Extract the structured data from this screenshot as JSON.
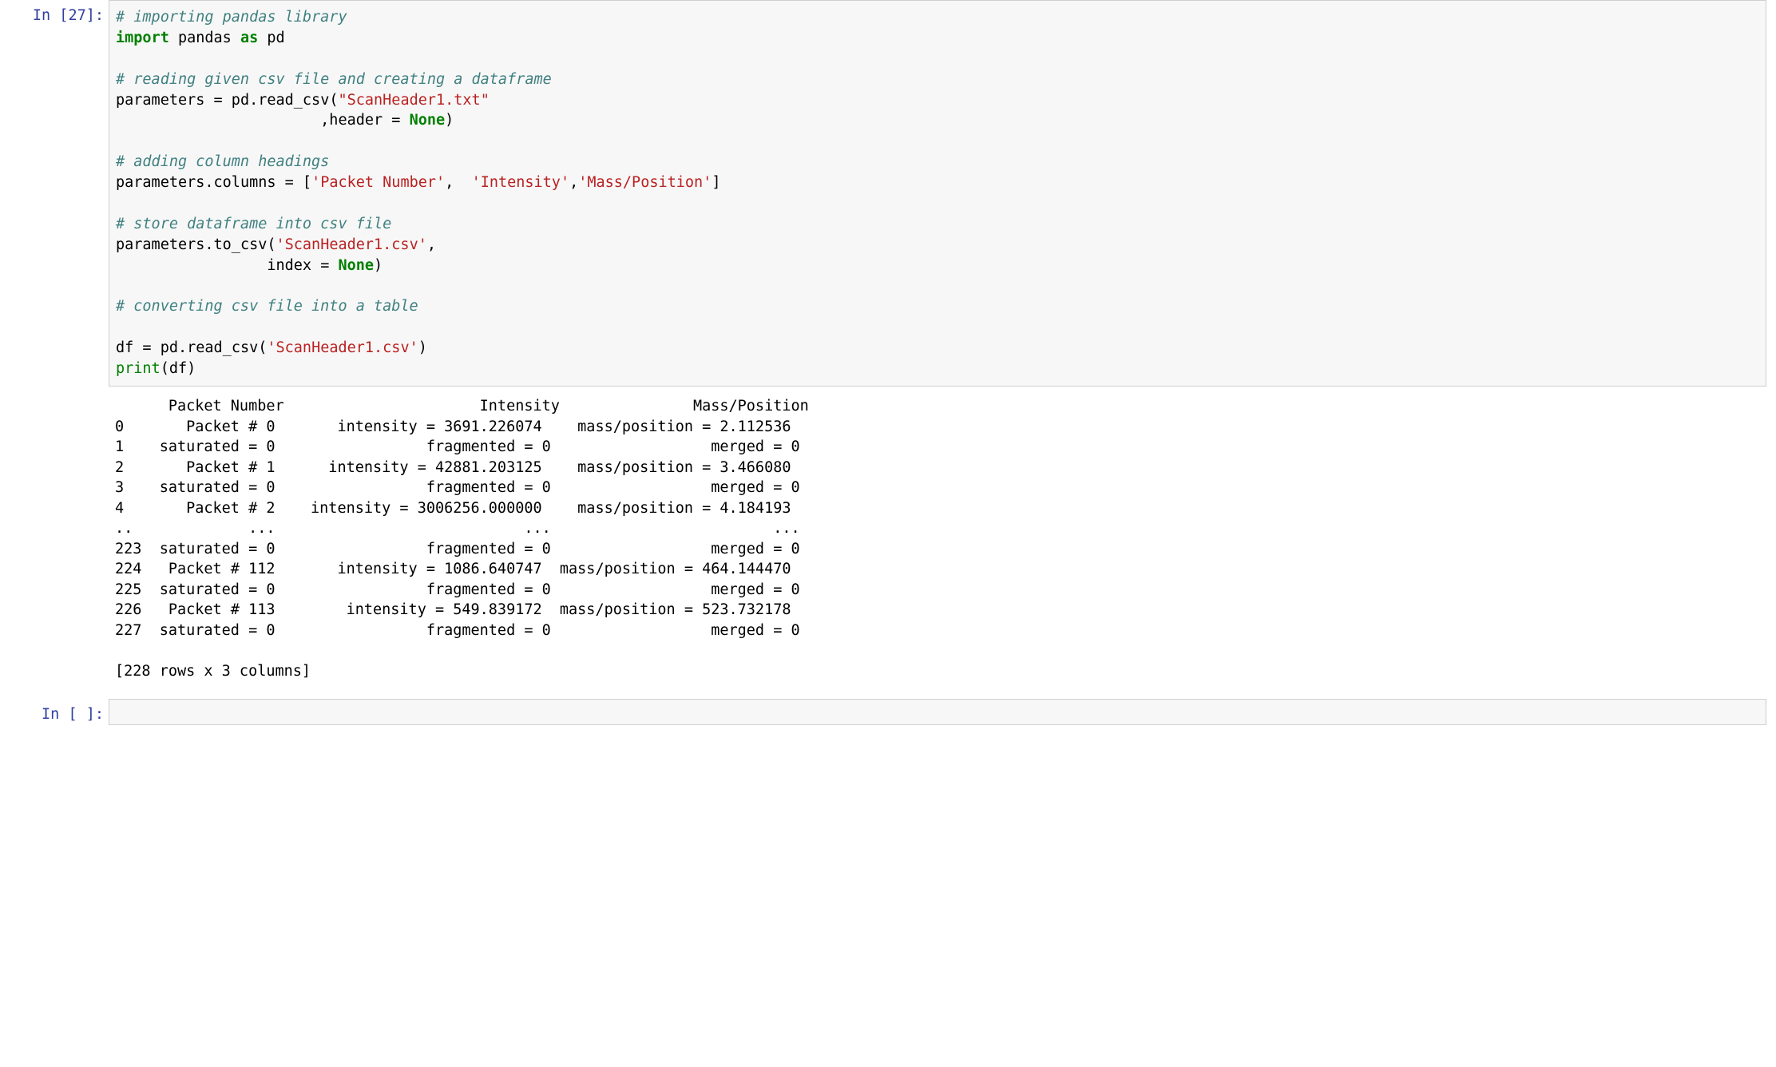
{
  "cell1": {
    "prompt": "In [27]:",
    "code": {
      "c1": "# importing pandas library",
      "l2_import": "import",
      "l2_pandas": " pandas ",
      "l2_as": "as",
      "l2_pd": " pd",
      "c2": "# reading given csv file and creating a dataframe",
      "l5_lhs": "parameters ",
      "l5_eq": "=",
      "l5_rhs_a": " pd",
      "l5_dot": ".",
      "l5_rhs_b": "read_csv",
      "l5_paren_o": "(",
      "l5_str": "\"ScanHeader1.txt\"",
      "l6_pad": "                       ,header ",
      "l6_eq": "=",
      "l6_sp": " ",
      "l6_none": "None",
      "l6_paren_c": ")",
      "c3": "# adding column headings",
      "l9_lhs": "parameters",
      "l9_dot": ".",
      "l9_cols": "columns ",
      "l9_eq": "=",
      "l9_sp": " [",
      "l9_s1": "'Packet Number'",
      "l9_comma1": ",  ",
      "l9_s2": "'Intensity'",
      "l9_comma2": ",",
      "l9_s3": "'Mass/Position'",
      "l9_close": "]",
      "c4": "# store dataframe into csv file",
      "l12_lhs": "parameters",
      "l12_dot": ".",
      "l12_method": "to_csv",
      "l12_paren_o": "(",
      "l12_str": "'ScanHeader1.csv'",
      "l12_comma": ",",
      "l13_pad": "                 index ",
      "l13_eq": "=",
      "l13_sp": " ",
      "l13_none": "None",
      "l13_paren_c": ")",
      "c5": "# converting csv file into a table",
      "l16_lhs": "df ",
      "l16_eq": "=",
      "l16_rhs": " pd",
      "l16_dot": ".",
      "l16_method": "read_csv",
      "l16_paren_o": "(",
      "l16_str": "'ScanHeader1.csv'",
      "l16_paren_c": ")",
      "l17_print": "print",
      "l17_paren_o": "(",
      "l17_arg": "df",
      "l17_paren_c": ")"
    }
  },
  "output": {
    "line0": "      Packet Number                      Intensity               Mass/Position",
    "line1": "0       Packet # 0       intensity = 3691.226074    mass/position = 2.112536",
    "line2": "1    saturated = 0                 fragmented = 0                  merged = 0",
    "line3": "2       Packet # 1      intensity = 42881.203125    mass/position = 3.466080",
    "line4": "3    saturated = 0                 fragmented = 0                  merged = 0",
    "line5": "4       Packet # 2    intensity = 3006256.000000    mass/position = 4.184193",
    "line6": "..             ...                            ...                         ...",
    "line7": "223  saturated = 0                 fragmented = 0                  merged = 0",
    "line8": "224   Packet # 112       intensity = 1086.640747  mass/position = 464.144470",
    "line9": "225  saturated = 0                 fragmented = 0                  merged = 0",
    "line10": "226   Packet # 113        intensity = 549.839172  mass/position = 523.732178",
    "line11": "227  saturated = 0                 fragmented = 0                  merged = 0",
    "footer": "[228 rows x 3 columns]"
  },
  "cell2": {
    "prompt": "In [ ]:"
  }
}
